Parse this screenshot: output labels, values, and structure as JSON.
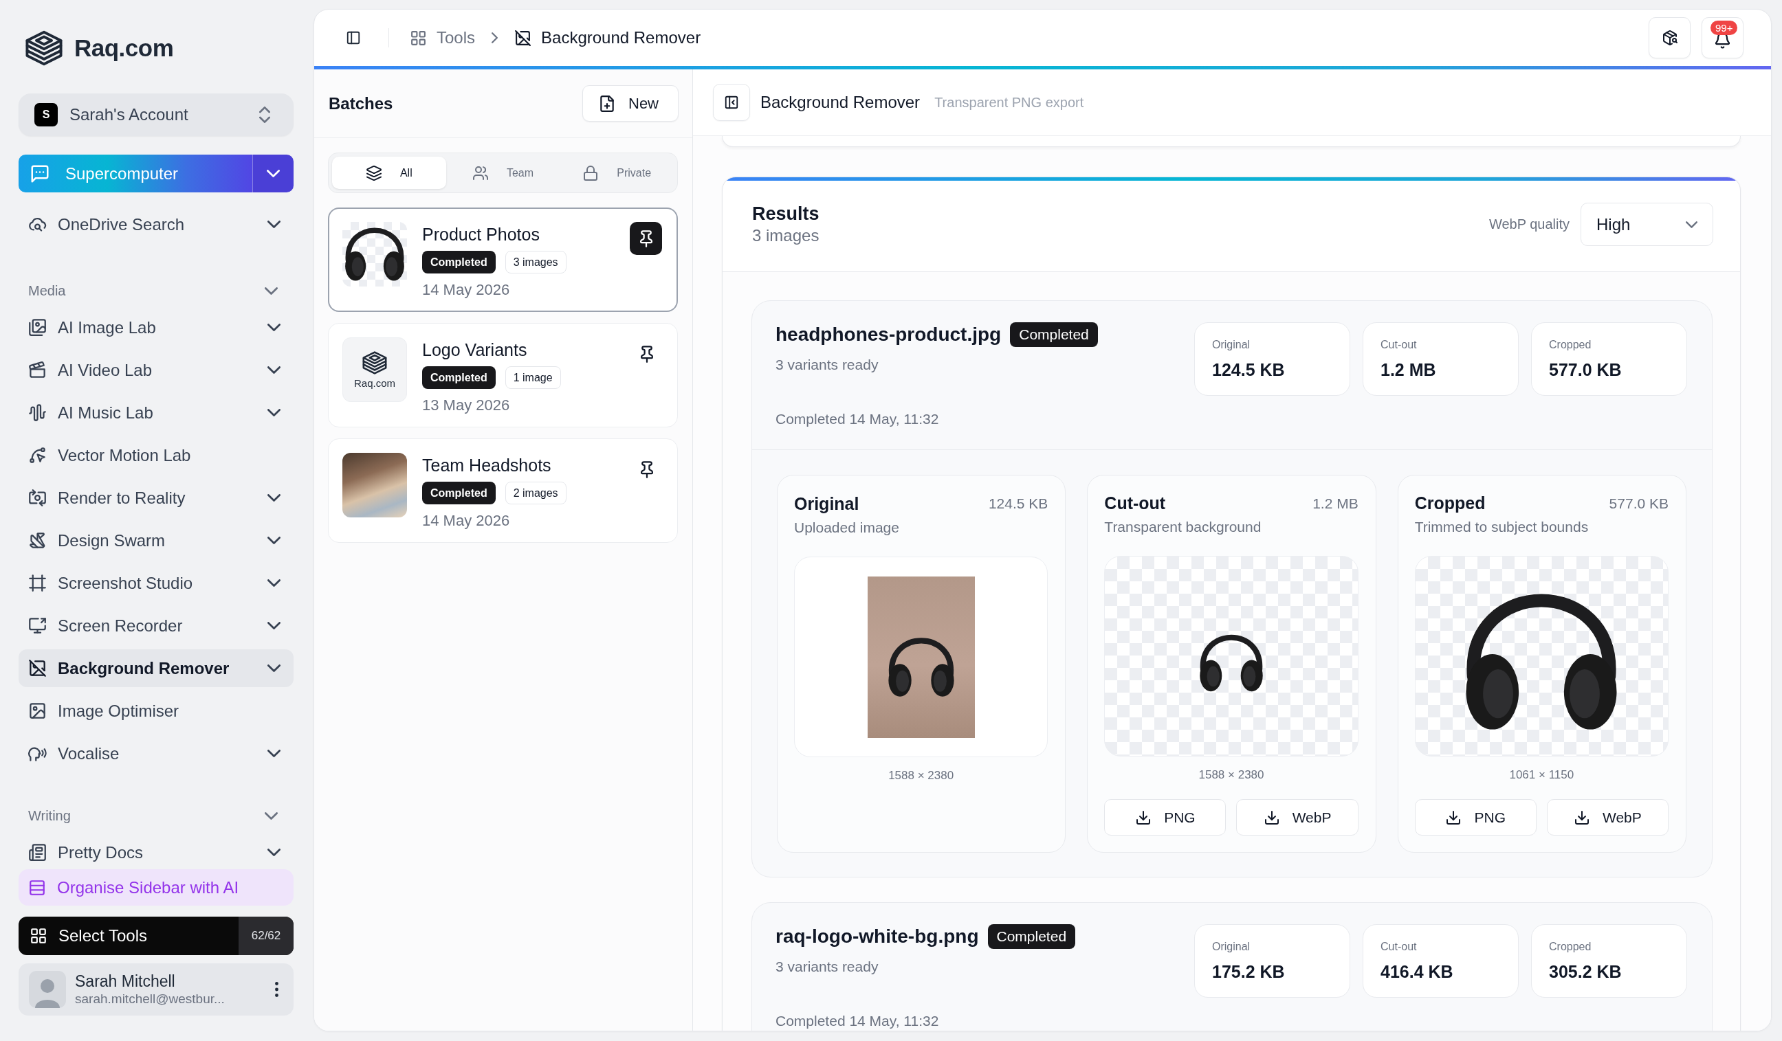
{
  "sidebar": {
    "brand": "Raq.com",
    "account": {
      "initial": "S",
      "name": "Sarah's Account"
    },
    "primary_action": {
      "label": "Supercomputer"
    },
    "items": [
      {
        "label": "OneDrive Search",
        "has_submenu": true,
        "selected": false
      }
    ],
    "sections": [
      {
        "title": "Media",
        "expanded": true,
        "items": [
          {
            "label": "AI Image Lab",
            "has_submenu": true,
            "selected": false
          },
          {
            "label": "AI Video Lab",
            "has_submenu": true,
            "selected": false
          },
          {
            "label": "AI Music Lab",
            "has_submenu": true,
            "selected": false
          },
          {
            "label": "Vector Motion Lab",
            "has_submenu": false,
            "selected": false
          },
          {
            "label": "Render to Reality",
            "has_submenu": true,
            "selected": false
          },
          {
            "label": "Design Swarm",
            "has_submenu": true,
            "selected": false
          },
          {
            "label": "Screenshot Studio",
            "has_submenu": true,
            "selected": false
          },
          {
            "label": "Screen Recorder",
            "has_submenu": true,
            "selected": false
          },
          {
            "label": "Background Remover",
            "has_submenu": true,
            "selected": true
          },
          {
            "label": "Image Optimiser",
            "has_submenu": false,
            "selected": false
          },
          {
            "label": "Vocalise",
            "has_submenu": true,
            "selected": false
          }
        ]
      },
      {
        "title": "Writing",
        "expanded": true,
        "items": [
          {
            "label": "Pretty Docs",
            "has_submenu": true,
            "selected": false
          }
        ]
      }
    ],
    "organise_button": "Organise Sidebar with AI",
    "select_tools": {
      "label": "Select Tools",
      "count": "62/62"
    },
    "user": {
      "name": "Sarah Mitchell",
      "email": "sarah.mitchell@westbur..."
    }
  },
  "header": {
    "breadcrumbs": [
      {
        "label": "Tools",
        "current": false
      },
      {
        "label": "Background Remover",
        "current": true
      }
    ],
    "notification_badge": "99+"
  },
  "batches": {
    "title": "Batches",
    "new_button": "New",
    "tabs": [
      {
        "label": "All",
        "selected": true
      },
      {
        "label": "Team",
        "selected": false
      },
      {
        "label": "Private",
        "selected": false
      }
    ],
    "items": [
      {
        "title": "Product Photos",
        "status": "Completed",
        "count": "3 images",
        "date": "14 May 2026",
        "selected": true,
        "pinned": true,
        "thumbnail": {
          "kind": "cutout"
        }
      },
      {
        "title": "Logo Variants",
        "status": "Completed",
        "count": "1 image",
        "date": "13 May 2026",
        "selected": false,
        "pinned": false,
        "thumbnail": {
          "kind": "logo",
          "text": "Raq.com"
        }
      },
      {
        "title": "Team Headshots",
        "status": "Completed",
        "count": "2 images",
        "date": "14 May 2026",
        "selected": false,
        "pinned": false,
        "thumbnail": {
          "kind": "photo"
        }
      }
    ]
  },
  "tool": {
    "title": "Background Remover",
    "subtitle": "Transparent PNG export"
  },
  "results": {
    "title": "Results",
    "count": "3 images",
    "quality": {
      "label": "WebP quality",
      "value": "High"
    },
    "files": [
      {
        "name": "headphones-product.jpg",
        "status": "Completed",
        "summary": "3 variants ready",
        "completed": "Completed 14 May, 11:32",
        "stats": [
          {
            "label": "Original",
            "value": "124.5 KB"
          },
          {
            "label": "Cut-out",
            "value": "1.2 MB"
          },
          {
            "label": "Cropped",
            "value": "577.0 KB"
          }
        ],
        "variants": [
          {
            "kind": "original",
            "title": "Original",
            "size": "124.5 KB",
            "subtitle": "Uploaded image",
            "dimensions": "1588 × 2380"
          },
          {
            "kind": "cutout",
            "title": "Cut-out",
            "size": "1.2 MB",
            "subtitle": "Transparent background",
            "dimensions": "1588 × 2380",
            "downloads": [
              "PNG",
              "WebP"
            ]
          },
          {
            "kind": "cropped",
            "title": "Cropped",
            "size": "577.0 KB",
            "subtitle": "Trimmed to subject bounds",
            "dimensions": "1061 × 1150",
            "downloads": [
              "PNG",
              "WebP"
            ]
          }
        ]
      },
      {
        "name": "raq-logo-white-bg.png",
        "status": "Completed",
        "summary": "3 variants ready",
        "completed": "Completed 14 May, 11:32",
        "stats": [
          {
            "label": "Original",
            "value": "175.2 KB"
          },
          {
            "label": "Cut-out",
            "value": "416.4 KB"
          },
          {
            "label": "Cropped",
            "value": "305.2 KB"
          }
        ]
      }
    ]
  }
}
